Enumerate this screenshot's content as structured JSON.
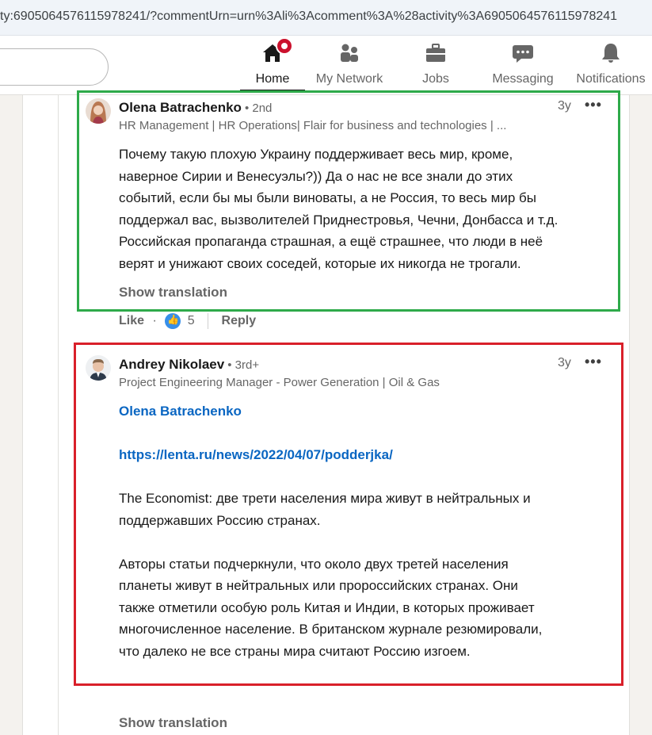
{
  "browser": {
    "url": "ty:6905064576115978241/?commentUrn=urn%3Ali%3Acomment%3A%28activity%3A6905064576115978241"
  },
  "nav": {
    "items": [
      {
        "label": "Home",
        "icon": "home-icon",
        "active": true
      },
      {
        "label": "My Network",
        "icon": "people-icon"
      },
      {
        "label": "Jobs",
        "icon": "briefcase-icon"
      },
      {
        "label": "Messaging",
        "icon": "chat-bubble-icon"
      },
      {
        "label": "Notifications",
        "icon": "bell-icon"
      }
    ]
  },
  "comments": [
    {
      "author": "Olena Batrachenko",
      "degree": "• 2nd",
      "headline": "HR Management | HR Operations| Flair for business and technologies | ...",
      "time": "3y",
      "more": "•••",
      "lines": [
        "Почему такую плохую Украину поддерживает весь мир, кроме,",
        "наверное Сирии и Венесуэлы?)) Да о нас не все знали до этих",
        "событий, если бы мы были виноваты, а не Россия, то весь мир бы",
        "поддержал вас, вызволителей Приднестровья, Чечни, Донбасса и т.д.",
        "Российская пропаганда страшная, а ещё страшнее, что люди в неё",
        "верят и унижают своих соседей, которые их никогда не трогали."
      ],
      "show_translation": "Show translation",
      "actions": {
        "like": "Like",
        "dot": "·",
        "like_count": "5",
        "reply": "Reply"
      }
    },
    {
      "author": "Andrey Nikolaev",
      "degree": "• 3rd+",
      "headline": "Project Engineering Manager - Power Generation | Oil & Gas",
      "time": "3y",
      "more": "•••",
      "mention": "Olena Batrachenko",
      "link": "https://lenta.ru/news/2022/04/07/podderjka/",
      "para1": [
        "The Economist: две трети населения мира живут в нейтральных и",
        "поддержавших Россию странах."
      ],
      "para2": [
        "Авторы статьи подчеркнули, что около двух третей населения",
        "планеты живут в нейтральных или пророссийских странах. Они",
        "также отметили особую роль Китая и Индии, в которых проживает",
        "многочисленное население. В британском журнале резюмировали,",
        "что далеко не все страны мира считают Россию изгоем."
      ],
      "show_translation": "Show translation"
    }
  ],
  "annotations": {
    "green_box_color": "#2eaa4a",
    "red_box_color": "#d9202a"
  }
}
